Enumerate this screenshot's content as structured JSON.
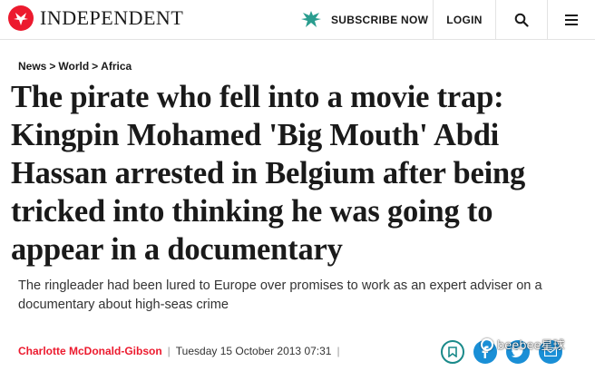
{
  "header": {
    "logo_text": "INDEPENDENT",
    "subscribe_label": "SUBSCRIBE NOW",
    "login_label": "LOGIN",
    "search_icon": "search-icon",
    "menu_icon": "hamburger-menu-icon"
  },
  "breadcrumb": {
    "items": [
      "News",
      "World",
      "Africa"
    ],
    "separator": ">"
  },
  "article": {
    "headline": "The pirate who fell into a movie trap: Kingpin Mohamed 'Big Mouth' Abdi Hassan arrested in Belgium after being tricked into thinking he was going to appear in a documentary",
    "standfirst": "The ringleader had been lured to Europe over promises to work as an expert adviser on a documentary about high-seas crime",
    "author": "Charlotte McDonald-Gibson",
    "date": "Tuesday 15 October 2013 07:31",
    "pipe": "|"
  },
  "share": {
    "icons": [
      "bookmark-icon",
      "facebook-icon",
      "twitter-icon",
      "email-icon"
    ]
  },
  "watermark": {
    "text": "beebee星球"
  },
  "colors": {
    "brand_red": "#ec1a2e",
    "share_blue": "#1a8fd6",
    "save_teal": "#1a8a8a",
    "text": "#1a1a1a"
  }
}
